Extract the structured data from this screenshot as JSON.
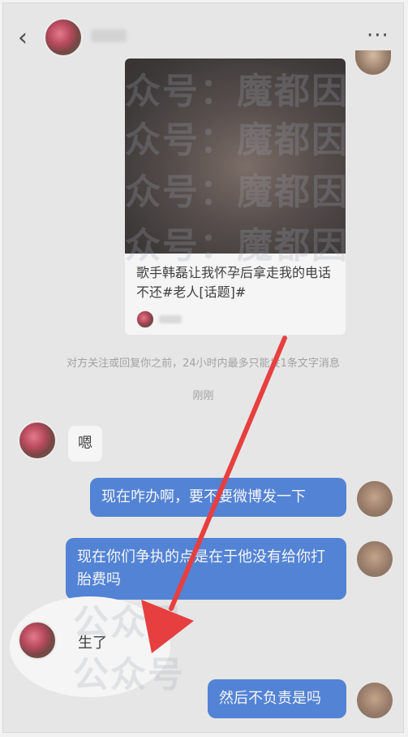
{
  "header": {
    "back_glyph": "‹",
    "more_glyph": "···"
  },
  "card": {
    "title": "歌手韩磊让我怀孕后拿走我的电话不还#老人[话题]#"
  },
  "system": {
    "notice": "对方关注或回复你之前，24小时内最多只能发1条文字消息",
    "time": "刚刚"
  },
  "messages": [
    {
      "side": "left",
      "text": "嗯"
    },
    {
      "side": "right",
      "text": "现在咋办啊，要不要微博发一下"
    },
    {
      "side": "right",
      "text": "现在你们争执的点是在于他没有给你打胎费吗"
    },
    {
      "side": "left",
      "text": "生了"
    },
    {
      "side": "right",
      "text": "然后不负责是吗"
    }
  ],
  "watermark": {
    "line1": "众号：魔都因",
    "line2": "公众号"
  },
  "annotation": {
    "arrow_color": "#ee2222",
    "highlight_color": "#ffffff"
  }
}
